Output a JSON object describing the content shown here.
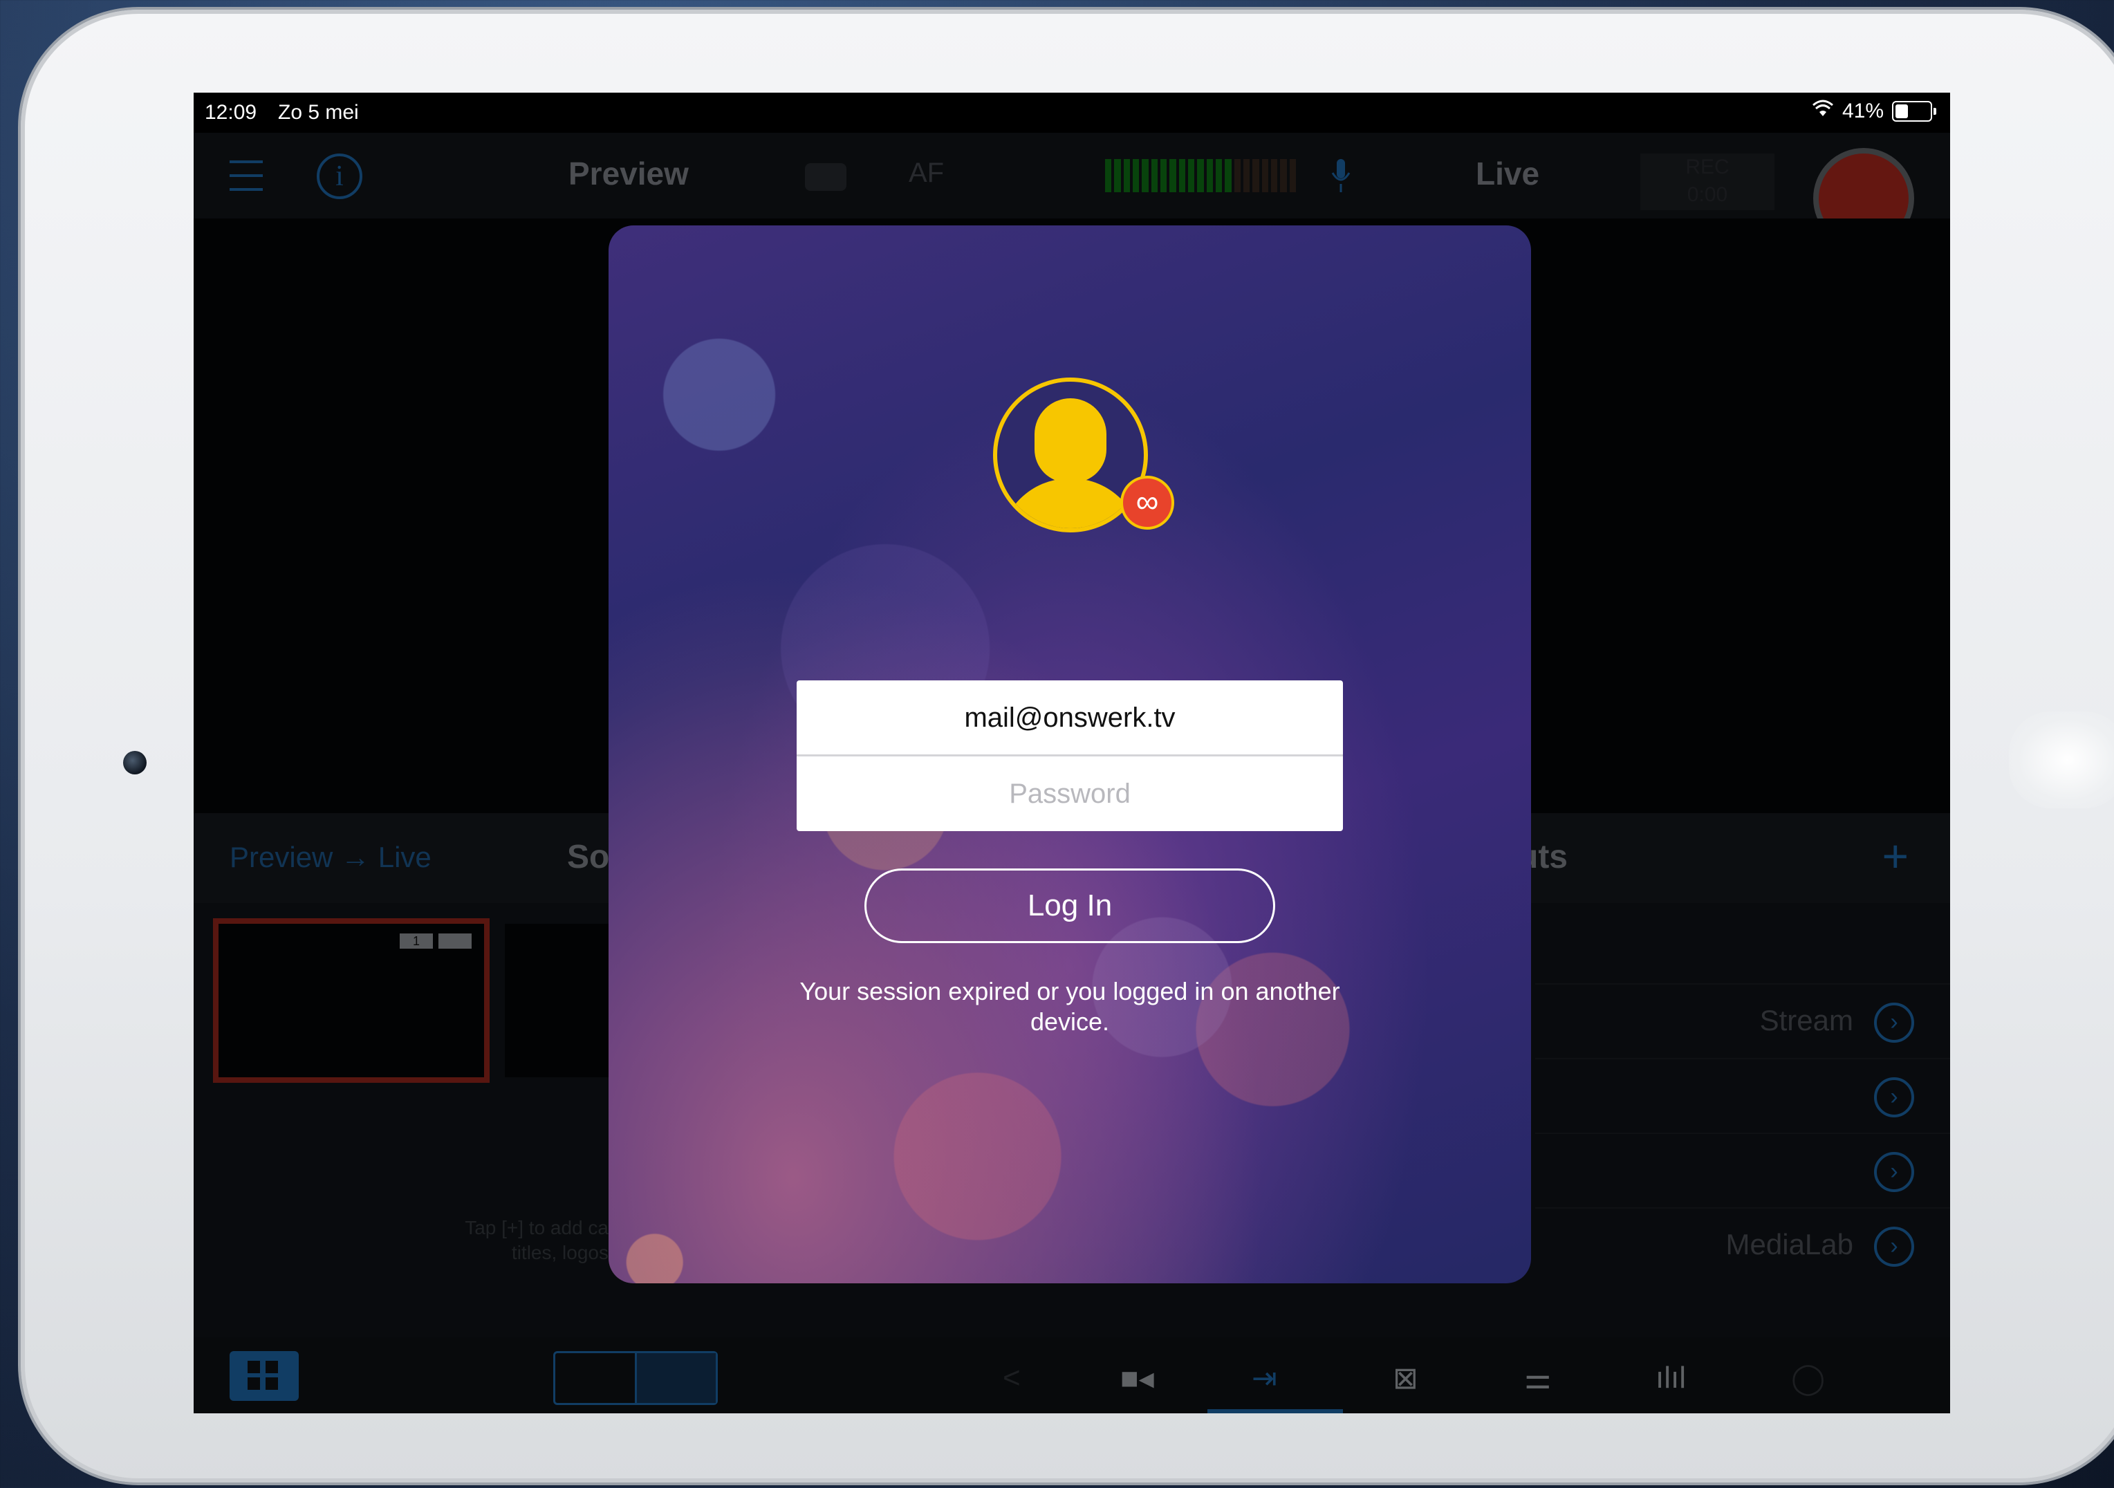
{
  "status_bar": {
    "time": "12:09",
    "date": "Zo 5 mei",
    "battery": "41%",
    "battery_level": 0.41
  },
  "top_bar": {
    "preview_title": "Preview",
    "af_label": "AF",
    "live_title": "Live",
    "rec_label": "REC",
    "rec_time": "0:00"
  },
  "panel": {
    "preview_live_link": "Preview → Live",
    "sources_title": "So",
    "outputs_title": "uts",
    "add_symbol": "+",
    "thumb_badge": "1",
    "tap_hint": "Tap [+] to add ca titles, logos",
    "outputs": [
      {
        "label": "Stream"
      },
      {
        "label": ""
      },
      {
        "label": ""
      },
      {
        "label": "MediaLab"
      }
    ]
  },
  "login": {
    "email_value": "mail@onswerk.tv",
    "password_placeholder": "Password",
    "login_button": "Log In",
    "message": "Your session expired or you logged in on another device."
  },
  "icons": {
    "menu": "hamburger-icon",
    "info": "info-icon",
    "camera": "camera-icon",
    "mic": "mic-icon",
    "grid": "grid-icon",
    "share": "share-icon",
    "video": "video-camera-icon",
    "output": "output-icon",
    "transition": "transition-icon",
    "mixer": "sliders-icon",
    "audio": "waveform-icon",
    "chat": "chat-icon"
  },
  "colors": {
    "accent": "#1f6fb6",
    "record": "#b72a1f",
    "avatar": "#f7c600"
  }
}
